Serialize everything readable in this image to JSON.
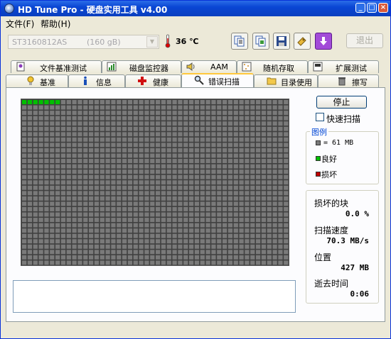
{
  "window": {
    "title": "HD Tune Pro - 硬盘实用工具 v4.00",
    "controls": [
      "_",
      "□",
      "×"
    ]
  },
  "menu": [
    {
      "label": "文件(F)"
    },
    {
      "label": "帮助(H)"
    }
  ],
  "toolbar": {
    "disk_name": "ST3160812AS",
    "disk_size": "(160 gB)",
    "temperature": "36 ℃",
    "exit_label": "退出",
    "icons": [
      "copy-text-icon",
      "copy-screenshot-icon",
      "save-icon",
      "options-icon",
      "download-icon"
    ]
  },
  "tabs_top": [
    {
      "label": "文件基准测试",
      "icon": "file-benchmark-icon"
    },
    {
      "label": "磁盘监控器",
      "icon": "disk-monitor-icon"
    },
    {
      "label": "AAM",
      "icon": "speaker-icon"
    },
    {
      "label": "随机存取",
      "icon": "random-access-icon"
    },
    {
      "label": "扩展测试",
      "icon": "extra-tests-icon"
    }
  ],
  "tabs_bottom": [
    {
      "label": "基准",
      "icon": "benchmark-icon"
    },
    {
      "label": "信息",
      "icon": "info-icon"
    },
    {
      "label": "健康",
      "icon": "health-icon"
    },
    {
      "label": "错误扫描",
      "icon": "magnifier-icon",
      "active": true
    },
    {
      "label": "目录使用",
      "icon": "folder-icon"
    },
    {
      "label": "擦写",
      "icon": "trash-icon"
    }
  ],
  "scan": {
    "stop_label": "停止",
    "quick_scan_label": "快速扫描",
    "quick_scan_checked": false,
    "grid": {
      "columns": 48,
      "rows": 31,
      "scanned_blocks": 7
    },
    "colors": {
      "unscanned": "#7a7a7a",
      "good": "#00c000",
      "bad": "#c00000",
      "background": "#404040"
    }
  },
  "legend": {
    "title": "图例",
    "block_size": "= 61 MB",
    "good": "良好",
    "bad": "损坏"
  },
  "stats": {
    "damaged_label": "损坏的块",
    "damaged_value": "0.0 %",
    "speed_label": "扫描速度",
    "speed_value": "70.3 MB/s",
    "position_label": "位置",
    "position_value": "427 MB",
    "elapsed_label": "逝去时间",
    "elapsed_value": "0:06"
  }
}
